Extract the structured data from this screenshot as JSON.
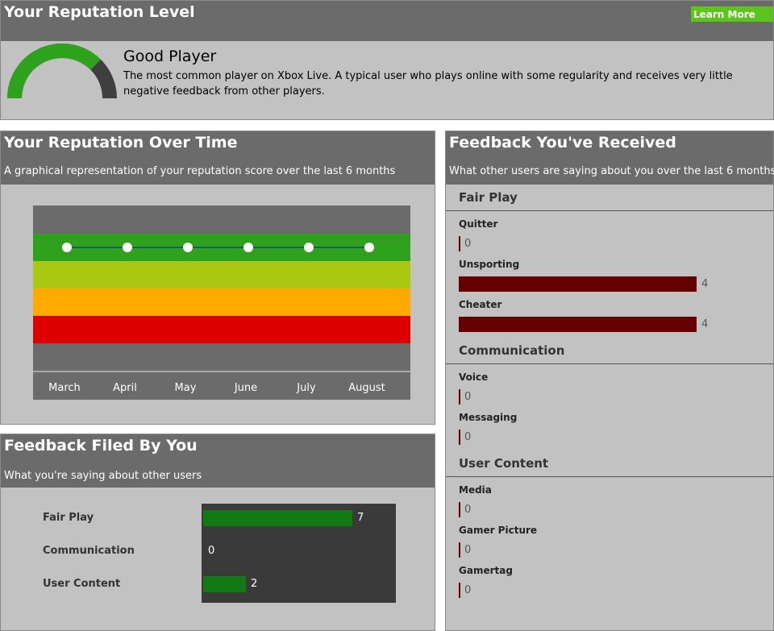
{
  "reputation_level": {
    "title": "Your Reputation Level",
    "learn_more": "Learn More",
    "name": "Good Player",
    "description": "The most common player on Xbox Live. A typical user who plays online with some regularity and receives very little negative feedback from other players.",
    "gauge_level": 0.75,
    "colors": {
      "gauge_fill": "#2fa21d",
      "gauge_track": "#3f3f3f"
    }
  },
  "reputation_time": {
    "title": "Your Reputation Over Time",
    "subtitle": "A graphical representation of your reputation score over the last 6 months",
    "colors": {
      "top": "#6b6b6b",
      "green": "#2fa21d",
      "lime": "#aac812",
      "orange": "#ffaa00",
      "red": "#dd0000",
      "bottom": "#6b6b6b",
      "line": "#1a3c8c",
      "point": "#ffffff",
      "axis_text": "#ffffff"
    }
  },
  "chart_data": {
    "type": "line",
    "categories": [
      "March",
      "April",
      "May",
      "June",
      "July",
      "August"
    ],
    "series": [
      {
        "values": [
          "Good Player",
          "Good Player",
          "Good Player",
          "Good Player",
          "Good Player",
          "Good Player"
        ]
      }
    ],
    "bands_top_to_bottom": [
      "",
      "green",
      "lime",
      "orange",
      "red",
      ""
    ],
    "point_band_index": 1
  },
  "feedback_filed": {
    "title": "Feedback Filed By You",
    "subtitle": "What you're saying about other users",
    "max_value": 8,
    "items": [
      {
        "label": "Fair Play",
        "value": 7
      },
      {
        "label": "Communication",
        "value": 0
      },
      {
        "label": "User Content",
        "value": 2
      }
    ]
  },
  "feedback_received": {
    "title": "Feedback You've Received",
    "subtitle": "What other users are saying about you over the last 6 months",
    "max_value": 4,
    "categories": [
      {
        "title": "Fair Play",
        "items": [
          {
            "label": "Quitter",
            "value": 0
          },
          {
            "label": "Unsporting",
            "value": 4
          },
          {
            "label": "Cheater",
            "value": 4
          }
        ]
      },
      {
        "title": "Communication",
        "items": [
          {
            "label": "Voice",
            "value": 0
          },
          {
            "label": "Messaging",
            "value": 0
          }
        ]
      },
      {
        "title": "User Content",
        "items": [
          {
            "label": "Media",
            "value": 0
          },
          {
            "label": "Gamer Picture",
            "value": 0
          },
          {
            "label": "Gamertag",
            "value": 0
          }
        ]
      }
    ]
  }
}
